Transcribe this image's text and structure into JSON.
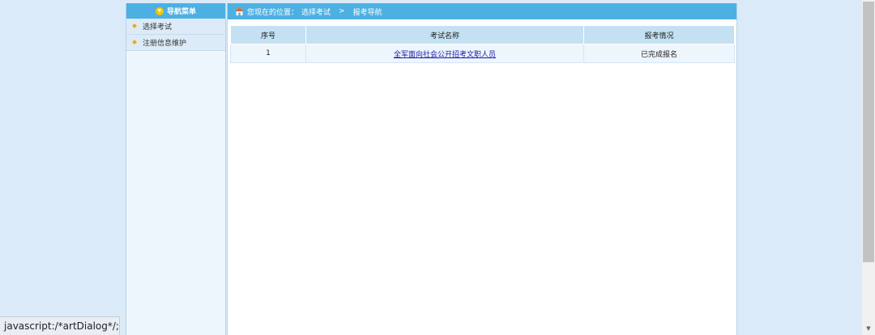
{
  "nav": {
    "header_label": "导航菜单",
    "items": [
      {
        "label": "选择考试"
      },
      {
        "label": "注册信息维护"
      }
    ]
  },
  "breadcrumb": {
    "prefix": "您现在的位置：",
    "parent": "选择考试",
    "separator": ">",
    "current": "报考导航"
  },
  "table": {
    "headers": [
      "序号",
      "考试名称",
      "报考情况"
    ],
    "rows": [
      {
        "index": "1",
        "exam_name": "全军面向社会公开招考文职人员",
        "status": "已完成报名"
      }
    ]
  },
  "statusbar": {
    "text": "javascript:/*artDialog*/;"
  }
}
